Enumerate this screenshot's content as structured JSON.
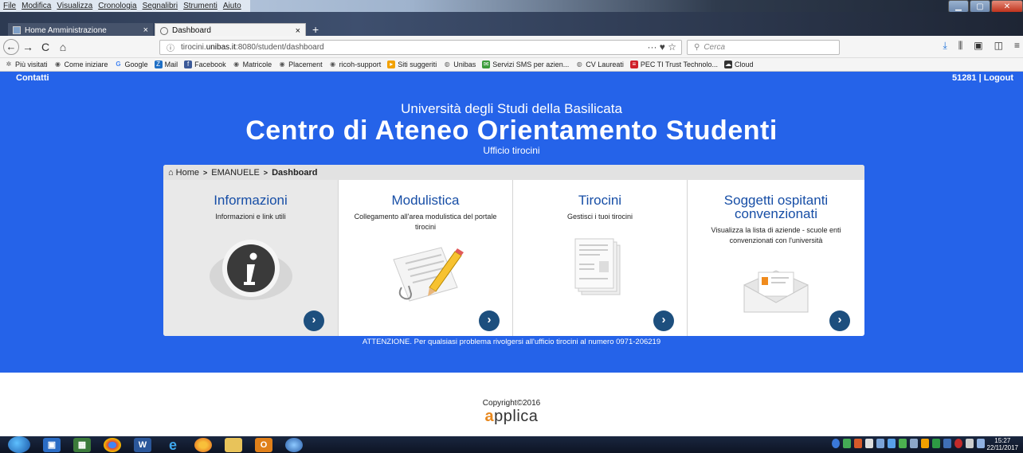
{
  "menubar": {
    "items": [
      "File",
      "Modifica",
      "Visualizza",
      "Cronologia",
      "Segnalibri",
      "Strumenti",
      "Aiuto"
    ]
  },
  "tabs": [
    {
      "label": "Home Amministrazione",
      "close": "×"
    },
    {
      "label": "Dashboard",
      "close": "×"
    }
  ],
  "new_tab": "+",
  "nav": {
    "back": "←",
    "forward": "→",
    "reload": "C",
    "home": "⌂",
    "url_icon": "ⓘ",
    "url_prefix": "tirocini.",
    "url_host": "unibas.it",
    "url_rest": ":8080/student/dashboard",
    "url_actions": "···  ♥  ☆",
    "search_placeholder": "Cerca"
  },
  "bookmarks": [
    "Più visitati",
    "Come iniziare",
    "Google",
    "Mail",
    "Facebook",
    "Matricole",
    "Placement",
    "ricoh-support",
    "Siti suggeriti",
    "Unibas",
    "Servizi SMS per azien...",
    "CV Laureati",
    "PEC TI Trust Technolo...",
    "Cloud"
  ],
  "header": {
    "contacts": "Contatti",
    "user": "51281 | Logout",
    "university": "Università degli Studi della Basilicata",
    "title": "Centro di Ateneo Orientamento Studenti",
    "subtitle": "Ufficio tirocini"
  },
  "breadcrumb": {
    "home": "Home",
    "sep": ">",
    "student": "EMANUELE",
    "current": "Dashboard"
  },
  "cards": [
    {
      "title": "Informazioni",
      "desc": "Informazioni e link utili"
    },
    {
      "title": "Modulistica",
      "desc": "Collegamento all'area modulistica del portale tirocini"
    },
    {
      "title": "Tirocini",
      "desc": "Gestisci i tuoi tirocini"
    },
    {
      "title": "Soggetti ospitanti convenzionati",
      "desc": "Visualizza la lista di aziende - scuole enti convenzionati con l'università"
    }
  ],
  "go_arrow": "›",
  "notice": "ATTENZIONE. Per qualsiasi problema rivolgersi all'ufficio tirocini al numero 0971-206219",
  "footer": {
    "copyright": "Copyright©2016",
    "brand_a": "a",
    "brand_rest": "pplica"
  },
  "clock": {
    "time": "15:27",
    "date": "22/11/2017"
  },
  "colors": {
    "page_bg": "#2563e9",
    "card_title": "#174ea6",
    "go_button": "#1d4f7e",
    "brand_accent": "#e8881e"
  }
}
